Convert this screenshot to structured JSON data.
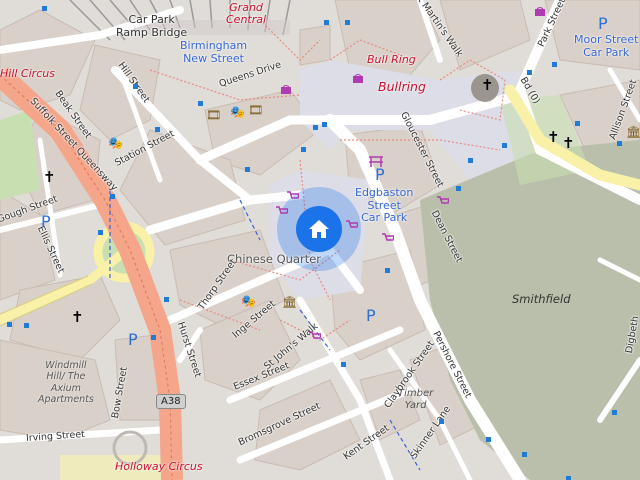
{
  "map": {
    "labels": {
      "car_park_ramp_bridge": "Car Park\nRamp Bridge",
      "grand_central": "Grand\nCentral",
      "birmingham_new_street": "Birmingham\nNew Street",
      "queens_drive": "Queens Drive",
      "bull_ring": "Bull Ring",
      "bullring": "Bullring",
      "martins_walk": "St Martin's Walk",
      "park_street": "Park Street",
      "moor_street_car_park": "Moor Street\nCar Park",
      "bd_label": "Bd (0)",
      "hill_street": "Hill Street",
      "beak_street": "Beak Street",
      "station_street": "Station Street",
      "suffolk_street_queensway": "Suffolk Street Queensway",
      "hill_circus": "Hill Circus",
      "gough_street": "Gough Street",
      "ellis_street": "Ellis Street",
      "gloucester_street": "Gloucester Street",
      "edgbaston_street_car_park": "Edgbaston\nStreet\nCar Park",
      "dean_street": "Dean Street",
      "chinese_quarter": "Chinese Quarter",
      "smithfield": "Smithfield",
      "allison_street": "Allison Street",
      "thorp_street": "Thorp Street",
      "inge_street": "Inge Street",
      "st_johns_walk": "St John's Walk",
      "hurst_street": "Hurst Street",
      "pershore_street": "Pershore Street",
      "essex_street": "Essex Street",
      "windmill": "Windmill\nHill/ The\nAxium\nApartments",
      "bow_street": "Bow Street",
      "a38": "A38",
      "irving_street": "Irving Street",
      "bromsgrove_street": "Bromsgrove Street",
      "claybrook_street": "Claybrook Street",
      "timber_yard": "Timber\nYard",
      "skinner_lane": "Skinner Lane",
      "kent_street": "Kent Street",
      "holloway_circus": "Holloway Circus",
      "digbeth": "Digbeth"
    },
    "parking_symbol": "P",
    "church_symbol": "✝",
    "colors": {
      "background": "#e0dcd7",
      "building": "#d9d0c9",
      "road": "#ffffff",
      "trunk_road": "#f4a58a",
      "primary_road": "#f8f1a7",
      "park": "#c8dfb1",
      "smithfield": "#b9bfaa",
      "pedestrian": "#dddde8",
      "red_label": "#c8102e",
      "blue_label": "#3465d4",
      "bus_stop": "#1f7cd6",
      "home_button": "#1a73e8"
    },
    "icons": [
      "home-icon",
      "parking-icon",
      "church-icon",
      "shop-icon",
      "theatre-icon",
      "bus-stop-icon"
    ]
  }
}
